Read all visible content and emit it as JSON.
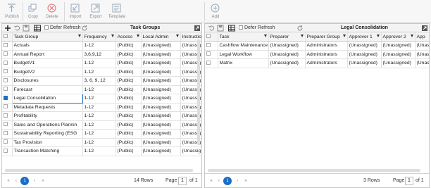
{
  "toolbar": {
    "publish": "Publish",
    "copy": "Copy",
    "delete": "Delete",
    "import": "Import",
    "export": "Export",
    "template": "Template",
    "add": "Add"
  },
  "left": {
    "title": "Task Groups",
    "defer_refresh": "Defer Refresh",
    "columns": [
      "Task Group",
      "Frequency",
      "Access",
      "Local Admin",
      "Instructio"
    ],
    "rows": [
      [
        "Actuals",
        "1-12",
        "(Public)",
        "(Unassigned)",
        "(Unassig"
      ],
      [
        "Annual Report",
        "3,6,9,12",
        "(Public)",
        "(Unassigned)",
        "(Unassig"
      ],
      [
        "BudgetV1",
        "1-12",
        "(Public)",
        "(Unassigned)",
        "(Unassig"
      ],
      [
        "BudgetV2",
        "1-12",
        "(Public)",
        "(Unassigned)",
        "(Unassig"
      ],
      [
        "Disclosures",
        "3, 6, 9, 12",
        "(Public)",
        "(Unassigned)",
        "(Unassig"
      ],
      [
        "Forecast",
        "1-12",
        "(Public)",
        "(Unassigned)",
        "(Unassig"
      ],
      [
        "Legal Consolidation",
        "1-12",
        "(Public)",
        "(Unassigned)",
        "(Unassig"
      ],
      [
        "Metadata Requests",
        "1-12",
        "(Public)",
        "(Unassigned)",
        "(Unassig"
      ],
      [
        "Profitability",
        "1-12",
        "(Public)",
        "(Unassigned)",
        "(Unassig"
      ],
      [
        "Sales and Operations Plannin",
        "1-12",
        "(Public)",
        "(Unassigned)",
        "(Unassig"
      ],
      [
        "Sustainability Reporting (ESG",
        "1-12",
        "(Public)",
        "(Unassigned)",
        "(Unassig"
      ],
      [
        "Tax Provision",
        "1-12",
        "(Public)",
        "(Unassigned)",
        "(Unassig"
      ],
      [
        "Transaction Matching",
        "1-12",
        "(Public)",
        "(Unassigned)",
        "(Unassig"
      ]
    ],
    "rows_label": "14 Rows",
    "page_label": "Page",
    "page_value": "1",
    "of_label": "of 1",
    "current_page": "1"
  },
  "right": {
    "title": "Legal Consolidation",
    "defer_refresh": "Defer Refresh",
    "columns": [
      "Task",
      "Preparer",
      "Preparer Group",
      "Approver 1",
      "Approver 2",
      "App"
    ],
    "rows": [
      [
        "Cashflow Maintenance",
        "(Unassigned)",
        "Administrators",
        "(Unassigned)",
        "(Unassigned)",
        "(Unas"
      ],
      [
        "Legal Workflow",
        "(Unassigned)",
        "Administrators",
        "(Unassigned)",
        "(Unassigned)",
        "(Unas"
      ],
      [
        "Matrix",
        "(Unassigned)",
        "Administrators",
        "(Unassigned)",
        "(Unassigned)",
        "(Unas"
      ]
    ],
    "rows_label": "3 Rows",
    "page_label": "Page",
    "page_value": "1",
    "of_label": "of 1",
    "current_page": "1"
  },
  "colors": {
    "accent": "#1a6fc4",
    "header_bg": "#f3f3f3"
  }
}
